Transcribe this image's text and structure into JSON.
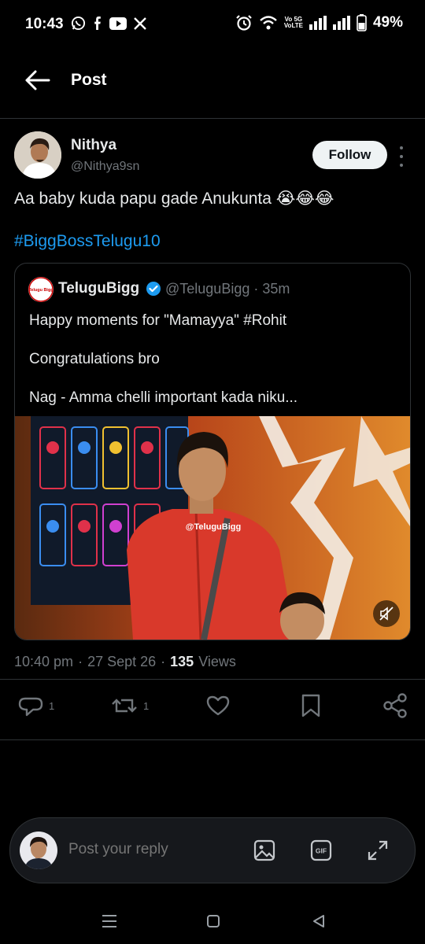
{
  "status_bar": {
    "time": "10:43",
    "network_label_top": "Vo 5G",
    "network_label_bottom": "VoLTE",
    "battery": "49%",
    "app_icons": [
      "whatsapp-icon",
      "facebook-icon",
      "youtube-icon",
      "x-icon"
    ],
    "system_icons": [
      "alarm-icon",
      "wifi-icon",
      "signal-icon",
      "signal-icon",
      "battery-icon"
    ]
  },
  "header": {
    "title": "Post"
  },
  "tweet": {
    "author_name": "Nithya",
    "author_handle": "@Nithya9sn",
    "follow_label": "Follow",
    "text": "Aa baby kuda papu gade Anukunta 😭😂😂",
    "hashtag": "#BiggBossTelugu10",
    "quote": {
      "avatar_text": "Telugu Bigg",
      "author_name": "TeluguBigg",
      "author_handle": "@TeluguBigg · 35m",
      "lines": [
        "Happy moments for \"Mamayya\" #Rohit",
        "Congratulations bro",
        "Nag - Amma chelli important kada niku..."
      ],
      "media_watermark": "@TeluguBigg"
    },
    "timestamp": "10:40 pm",
    "date": "27 Sept 26",
    "views_count": "135",
    "views_label": "Views",
    "reply_count": "1",
    "repost_count": "1"
  },
  "reply_bar": {
    "placeholder": "Post your reply",
    "gif_label": "GIF"
  },
  "colors": {
    "background": "#000000",
    "accent": "#1d9bf0",
    "muted": "#71767b",
    "text": "#e7e9ea"
  }
}
